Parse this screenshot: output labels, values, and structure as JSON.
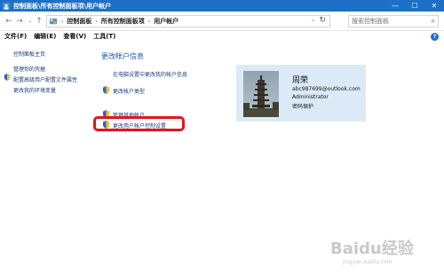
{
  "window": {
    "title": "控制面板\\所有控制面板项\\用户帐户",
    "controls": {
      "minimize": "—",
      "maximize": "☐",
      "close": "✕"
    }
  },
  "navigation": {
    "back": "←",
    "forward": "→",
    "dropdown": "⌄",
    "up": "↑",
    "breadcrumbs": [
      "控制面板",
      "所有控制面板项",
      "用户帐户"
    ],
    "refresh": "↻"
  },
  "search": {
    "placeholder": "搜索控制面板",
    "icon": "search-icon"
  },
  "menu": [
    "文件(F)",
    "编辑(E)",
    "查看(V)",
    "工具(T)"
  ],
  "help": "?",
  "sidebar": {
    "items": [
      {
        "label": "控制面板主页",
        "shield": false
      },
      {
        "label": "管理你的凭据",
        "shield": false
      },
      {
        "label": "配置高级用户配置文件属性",
        "shield": true
      },
      {
        "label": "更改我的环境变量",
        "shield": false
      }
    ]
  },
  "main": {
    "heading": "更改帐户信息",
    "links": [
      {
        "label": "在电脑设置中更改我的帐户信息",
        "shield": false
      },
      {
        "label": "更改帐户类型",
        "shield": true
      },
      {
        "label": "管理其他帐户",
        "shield": true
      },
      {
        "label": "更改用户帐户控制设置",
        "shield": true
      }
    ]
  },
  "user": {
    "name": "周荣",
    "email": "abc987699@outlook.com",
    "role": "Administrator",
    "status": "密码保护"
  },
  "watermark": {
    "text": "Baidu经验",
    "sub": "jingyan.baidu.com"
  },
  "colors": {
    "titlebar": "#1e6fc8",
    "link": "#1a3c7a",
    "heading": "#1a5aa8",
    "card": "#dceaf7",
    "highlight": "#e4141b"
  }
}
